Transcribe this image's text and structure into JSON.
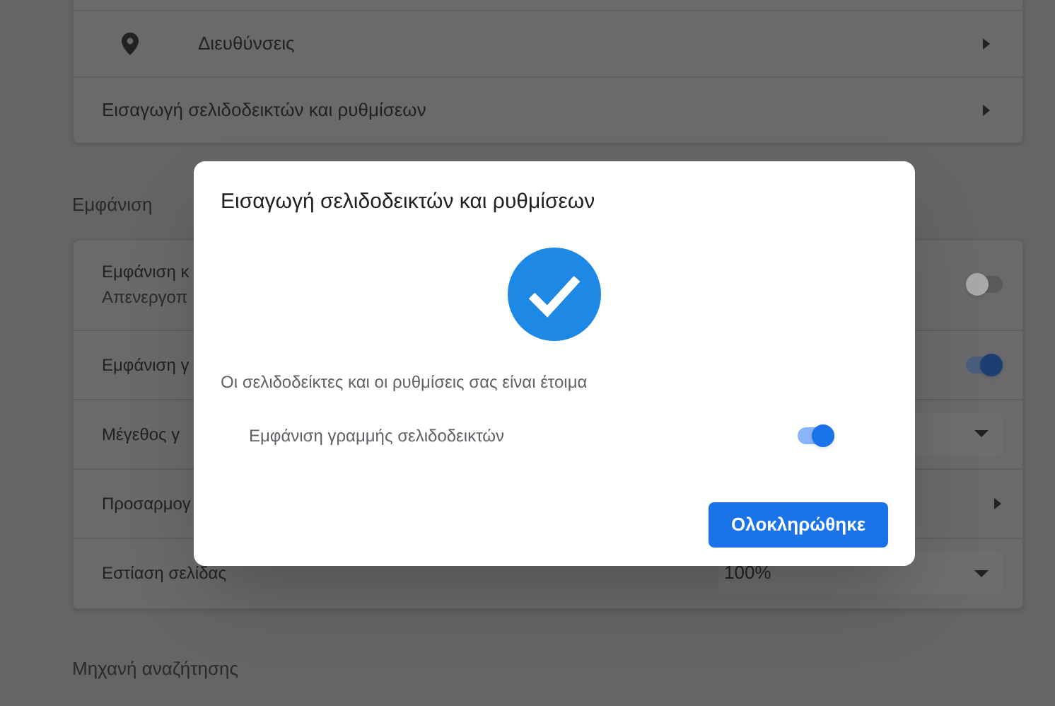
{
  "settings": {
    "top_card": [
      {
        "kind": "icon_link",
        "label": "Διευθύνσεις"
      },
      {
        "kind": "link",
        "label": "Εισαγωγή σελιδοδεικτών και ρυθμίσεων"
      }
    ],
    "appearance_heading": "Εμφάνιση",
    "appearance_card": [
      {
        "kind": "toggle",
        "label": "Εμφάνιση κ",
        "sublabel": "Απενεργοπ",
        "on": false
      },
      {
        "kind": "toggle",
        "label": "Εμφάνιση γ",
        "on": true
      },
      {
        "kind": "dropdown",
        "label": "Μέγεθος γ"
      },
      {
        "kind": "link",
        "label": "Προσαρμογ"
      },
      {
        "kind": "dropdown",
        "label": "Εστίαση σελίδας",
        "value": "100%"
      }
    ],
    "search_engine_heading": "Μηχανή αναζήτησης"
  },
  "dialog": {
    "title": "Εισαγωγή σελιδοδεικτών και ρυθμίσεων",
    "message": "Οι σελιδοδείκτες και οι ρυθμίσεις σας είναι έτοιμα",
    "toggle": {
      "label": "Εμφάνιση γραμμής σελιδοδεικτών",
      "on": true
    },
    "button": "Ολοκληρώθηκε"
  }
}
